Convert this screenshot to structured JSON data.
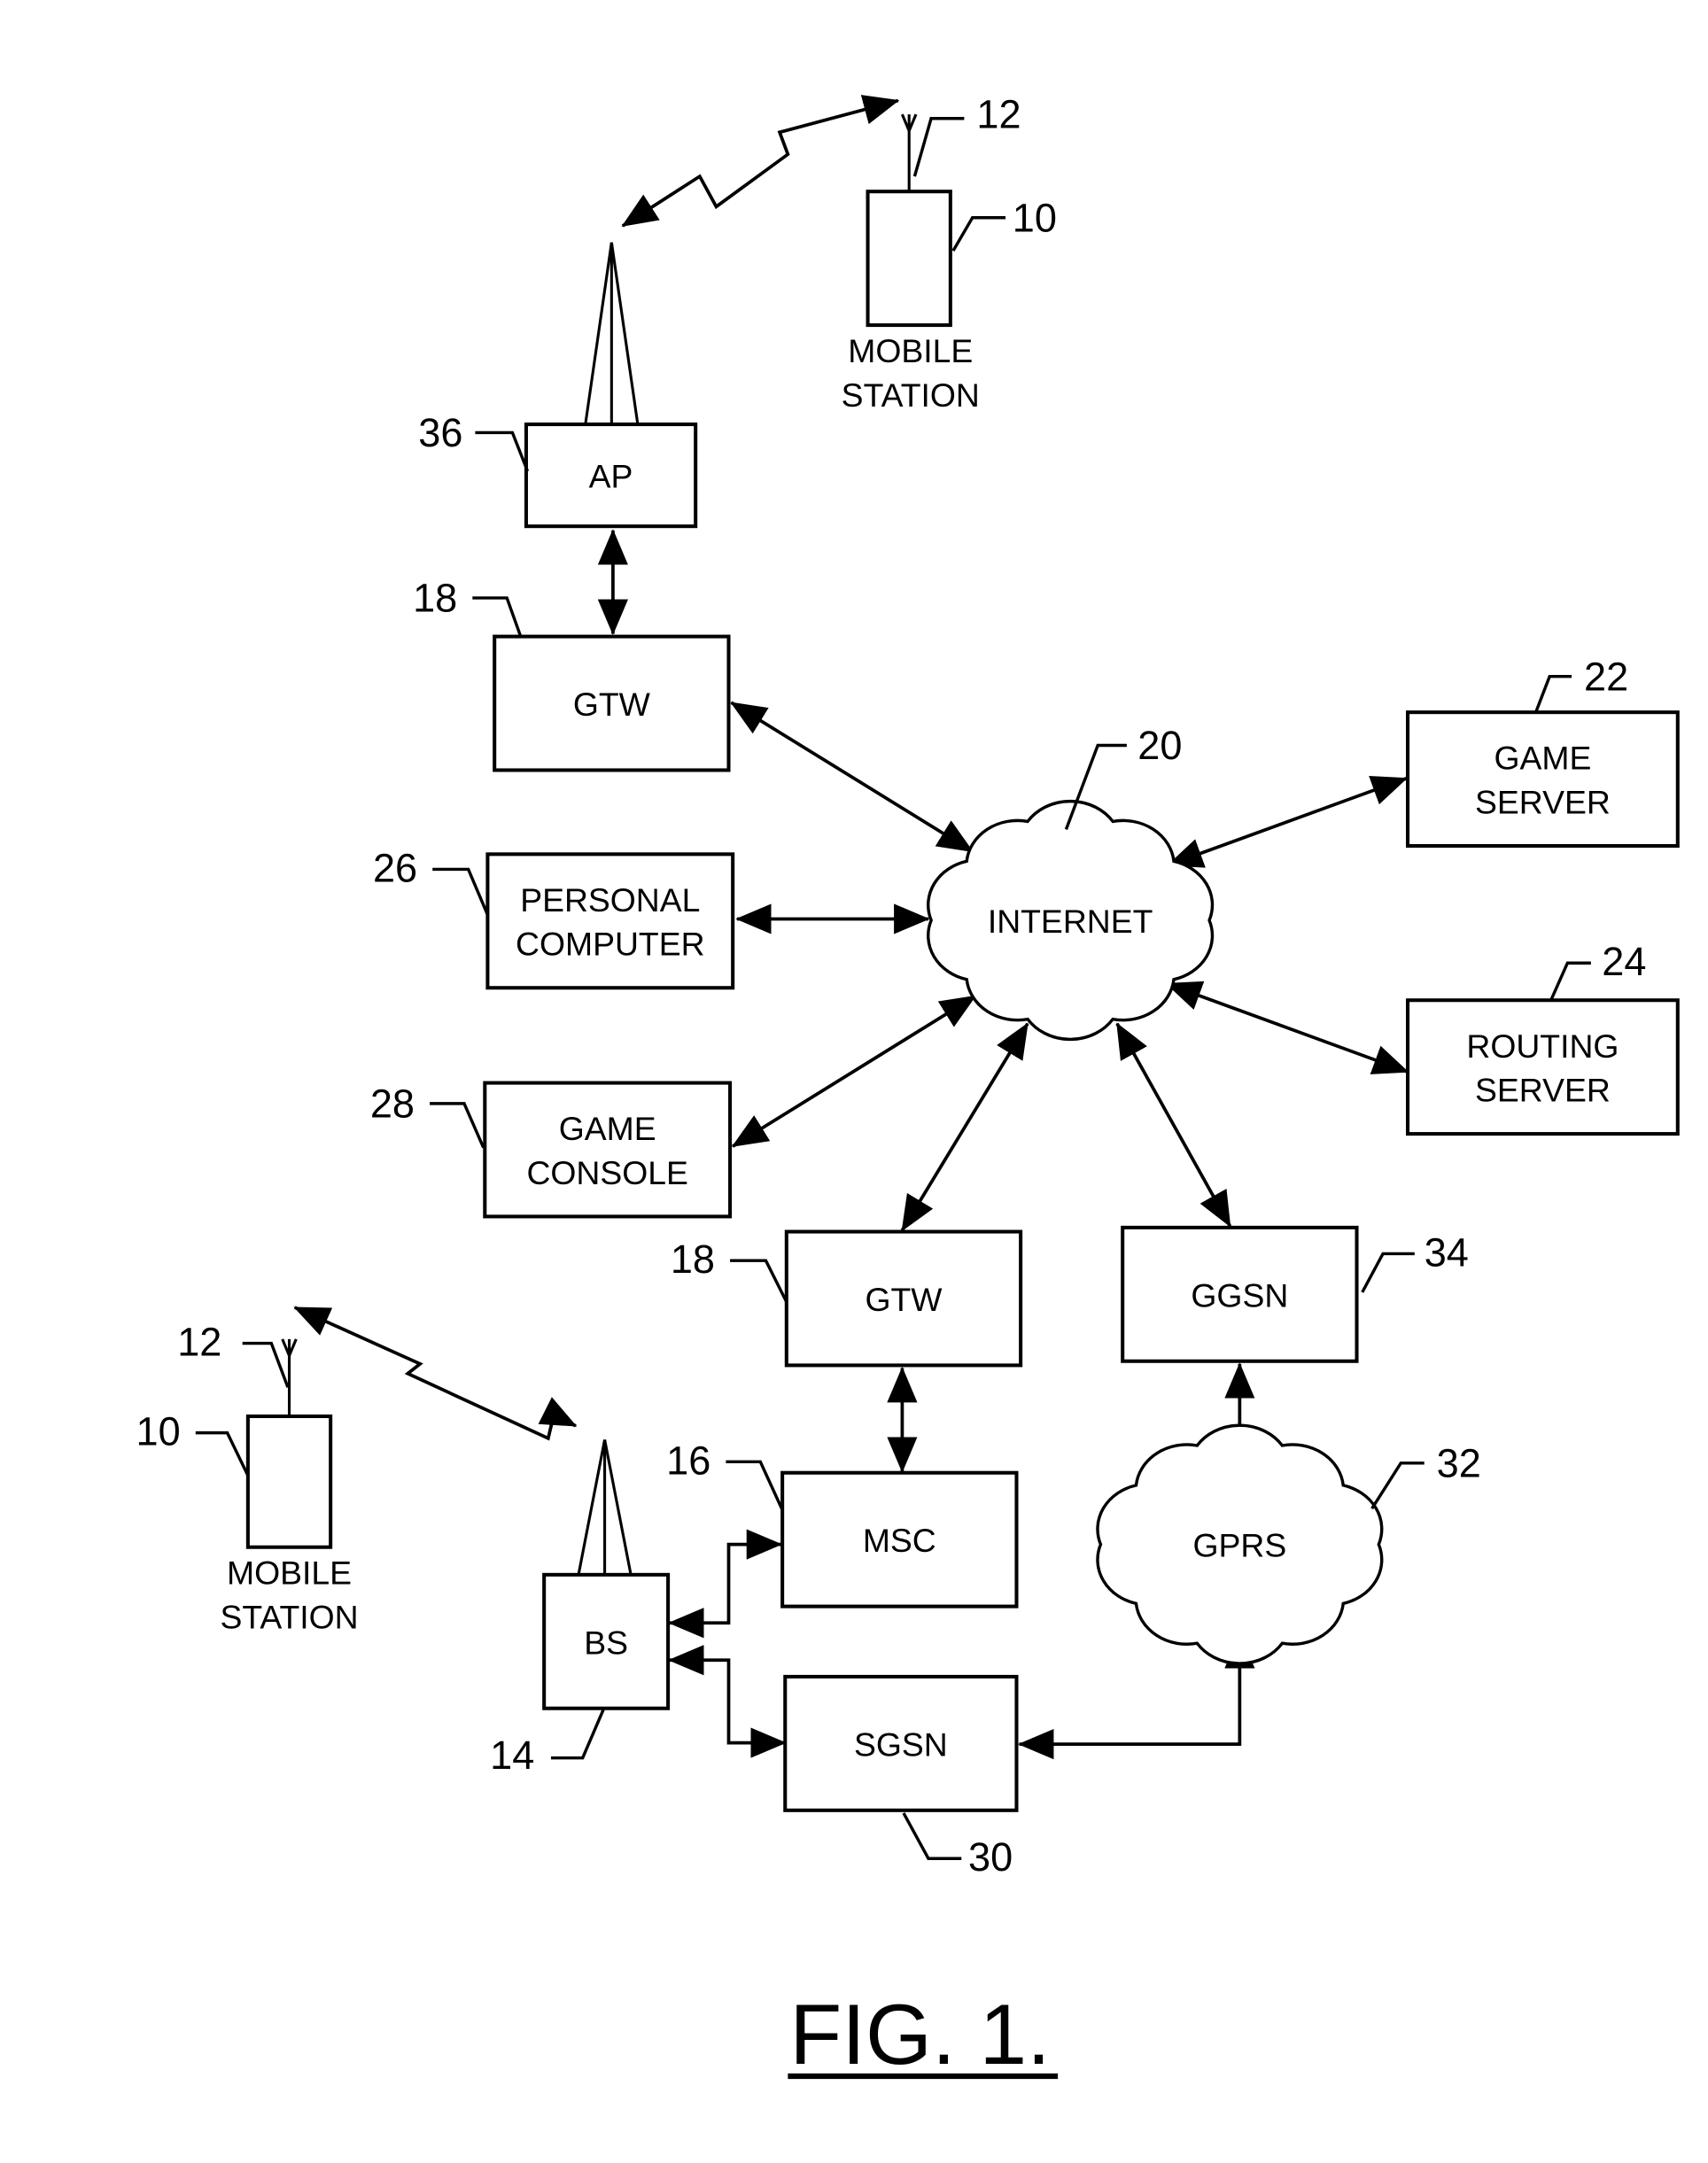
{
  "figure": {
    "caption": "FIG. 1."
  },
  "nodes": {
    "mobile_station_top": {
      "label_lines": [
        "MOBILE",
        "STATION"
      ],
      "ref": "10",
      "antenna_ref": "12"
    },
    "ap": {
      "label_lines": [
        "AP"
      ],
      "ref": "36"
    },
    "gtw_top": {
      "label_lines": [
        "GTW"
      ],
      "ref": "18"
    },
    "internet": {
      "label_lines": [
        "INTERNET"
      ],
      "ref": "20"
    },
    "game_server": {
      "label_lines": [
        "GAME",
        "SERVER"
      ],
      "ref": "22"
    },
    "routing_server": {
      "label_lines": [
        "ROUTING",
        "SERVER"
      ],
      "ref": "24"
    },
    "personal_computer": {
      "label_lines": [
        "PERSONAL",
        "COMPUTER"
      ],
      "ref": "26"
    },
    "game_console": {
      "label_lines": [
        "GAME",
        "CONSOLE"
      ],
      "ref": "28"
    },
    "gtw_bottom": {
      "label_lines": [
        "GTW"
      ],
      "ref": "18"
    },
    "ggsn": {
      "label_lines": [
        "GGSN"
      ],
      "ref": "34"
    },
    "msc": {
      "label_lines": [
        "MSC"
      ],
      "ref": "16"
    },
    "gprs": {
      "label_lines": [
        "GPRS"
      ],
      "ref": "32"
    },
    "bs": {
      "label_lines": [
        "BS"
      ],
      "ref": "14"
    },
    "sgsn": {
      "label_lines": [
        "SGSN"
      ],
      "ref": "30"
    },
    "mobile_station_bottom": {
      "label_lines": [
        "MOBILE",
        "STATION"
      ],
      "ref": "10",
      "antenna_ref": "12"
    }
  },
  "connections": [
    {
      "from": "mobile_station_top",
      "to": "ap",
      "kind": "wireless",
      "bidirectional": true
    },
    {
      "from": "ap",
      "to": "gtw_top",
      "kind": "wired",
      "bidirectional": true
    },
    {
      "from": "gtw_top",
      "to": "internet",
      "kind": "wired",
      "bidirectional": true
    },
    {
      "from": "personal_computer",
      "to": "internet",
      "kind": "wired",
      "bidirectional": true
    },
    {
      "from": "game_console",
      "to": "internet",
      "kind": "wired",
      "bidirectional": true
    },
    {
      "from": "game_server",
      "to": "internet",
      "kind": "wired",
      "bidirectional": true
    },
    {
      "from": "routing_server",
      "to": "internet",
      "kind": "wired",
      "bidirectional": true
    },
    {
      "from": "gtw_bottom",
      "to": "internet",
      "kind": "wired",
      "bidirectional": true
    },
    {
      "from": "ggsn",
      "to": "internet",
      "kind": "wired",
      "bidirectional": true
    },
    {
      "from": "gtw_bottom",
      "to": "msc",
      "kind": "wired",
      "bidirectional": true
    },
    {
      "from": "ggsn",
      "to": "gprs",
      "kind": "wired",
      "bidirectional": true
    },
    {
      "from": "bs",
      "to": "msc",
      "kind": "wired",
      "bidirectional": true
    },
    {
      "from": "bs",
      "to": "sgsn",
      "kind": "wired",
      "bidirectional": true
    },
    {
      "from": "sgsn",
      "to": "gprs",
      "kind": "wired",
      "bidirectional": true
    },
    {
      "from": "mobile_station_bottom",
      "to": "bs",
      "kind": "wireless",
      "bidirectional": true
    }
  ]
}
